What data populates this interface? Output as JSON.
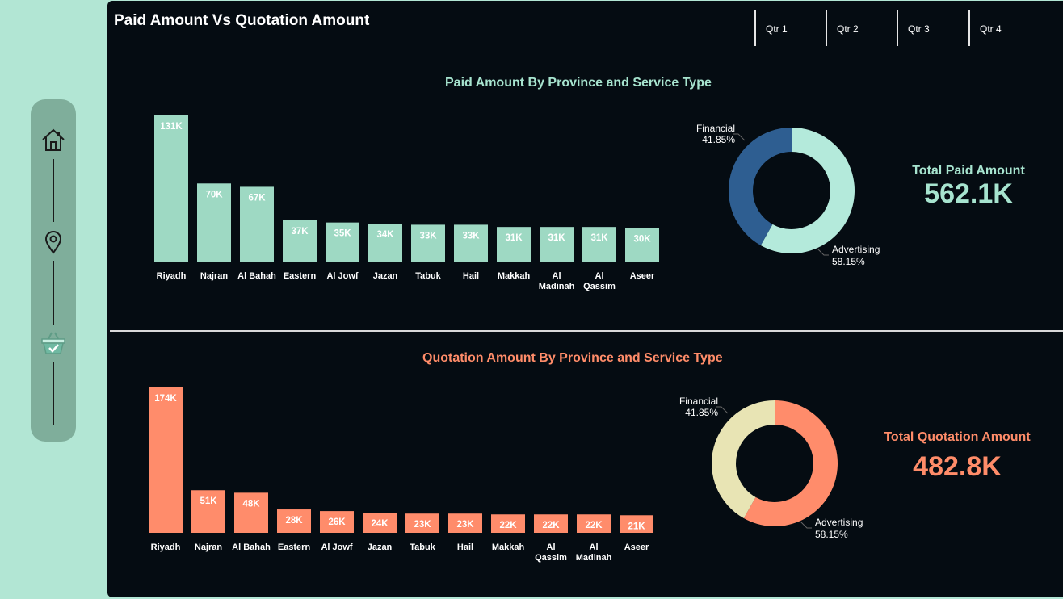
{
  "page": {
    "title": "Paid Amount Vs Quotation Amount"
  },
  "quarters": [
    "Qtr 1",
    "Qtr 2",
    "Qtr 3",
    "Qtr 4"
  ],
  "sidebar": {
    "icons": [
      "home-icon",
      "location-pin-icon",
      "basket-icon"
    ]
  },
  "colors": {
    "paid_bar": "#9ed9c3",
    "paid_title": "#a7e4cf",
    "quote_bar": "#ff8c6b",
    "quote_title": "#ff8c69",
    "financial_paid": "#2e5e91",
    "advertising_paid": "#b4eadb",
    "financial_quote": "#e8e4b4",
    "advertising_quote": "#ff8c6b"
  },
  "paid": {
    "section_title": "Paid Amount By Province and Service Type",
    "total_label": "Total Paid Amount",
    "total_value": "562.1K"
  },
  "quote": {
    "section_title": "Quotation Amount By Province and Service Type",
    "total_label": "Total Quotation Amount",
    "total_value": "482.8K"
  },
  "chart_data": [
    {
      "type": "bar",
      "title": "Paid Amount By Province and Service Type",
      "categories": [
        "Riyadh",
        "Najran",
        "Al Bahah",
        "Eastern",
        "Al Jowf",
        "Jazan",
        "Tabuk",
        "Hail",
        "Makkah",
        "Al Madinah",
        "Al Qassim",
        "Aseer"
      ],
      "values": [
        131,
        70,
        67,
        37,
        35,
        34,
        33,
        33,
        31,
        31,
        31,
        30
      ],
      "value_labels": [
        "131K",
        "70K",
        "67K",
        "37K",
        "35K",
        "34K",
        "33K",
        "33K",
        "31K",
        "31K",
        "31K",
        "30K"
      ]
    },
    {
      "type": "pie",
      "title": "",
      "labels": [
        "Financial",
        "Advertising"
      ],
      "values": [
        41.85,
        58.15
      ],
      "value_labels": [
        "41.85%",
        "58.15%"
      ]
    },
    {
      "type": "bar",
      "title": "Quotation Amount By Province and Service Type",
      "categories": [
        "Riyadh",
        "Najran",
        "Al Bahah",
        "Eastern",
        "Al Jowf",
        "Jazan",
        "Tabuk",
        "Hail",
        "Makkah",
        "Al Qassim",
        "Al Madinah",
        "Aseer"
      ],
      "values": [
        174,
        51,
        48,
        28,
        26,
        24,
        23,
        23,
        22,
        22,
        22,
        21
      ],
      "value_labels": [
        "174K",
        "51K",
        "48K",
        "28K",
        "26K",
        "24K",
        "23K",
        "23K",
        "22K",
        "22K",
        "22K",
        "21K"
      ]
    },
    {
      "type": "pie",
      "title": "",
      "labels": [
        "Financial",
        "Advertising"
      ],
      "values": [
        41.85,
        58.15
      ],
      "value_labels": [
        "41.85%",
        "58.15%"
      ]
    }
  ]
}
